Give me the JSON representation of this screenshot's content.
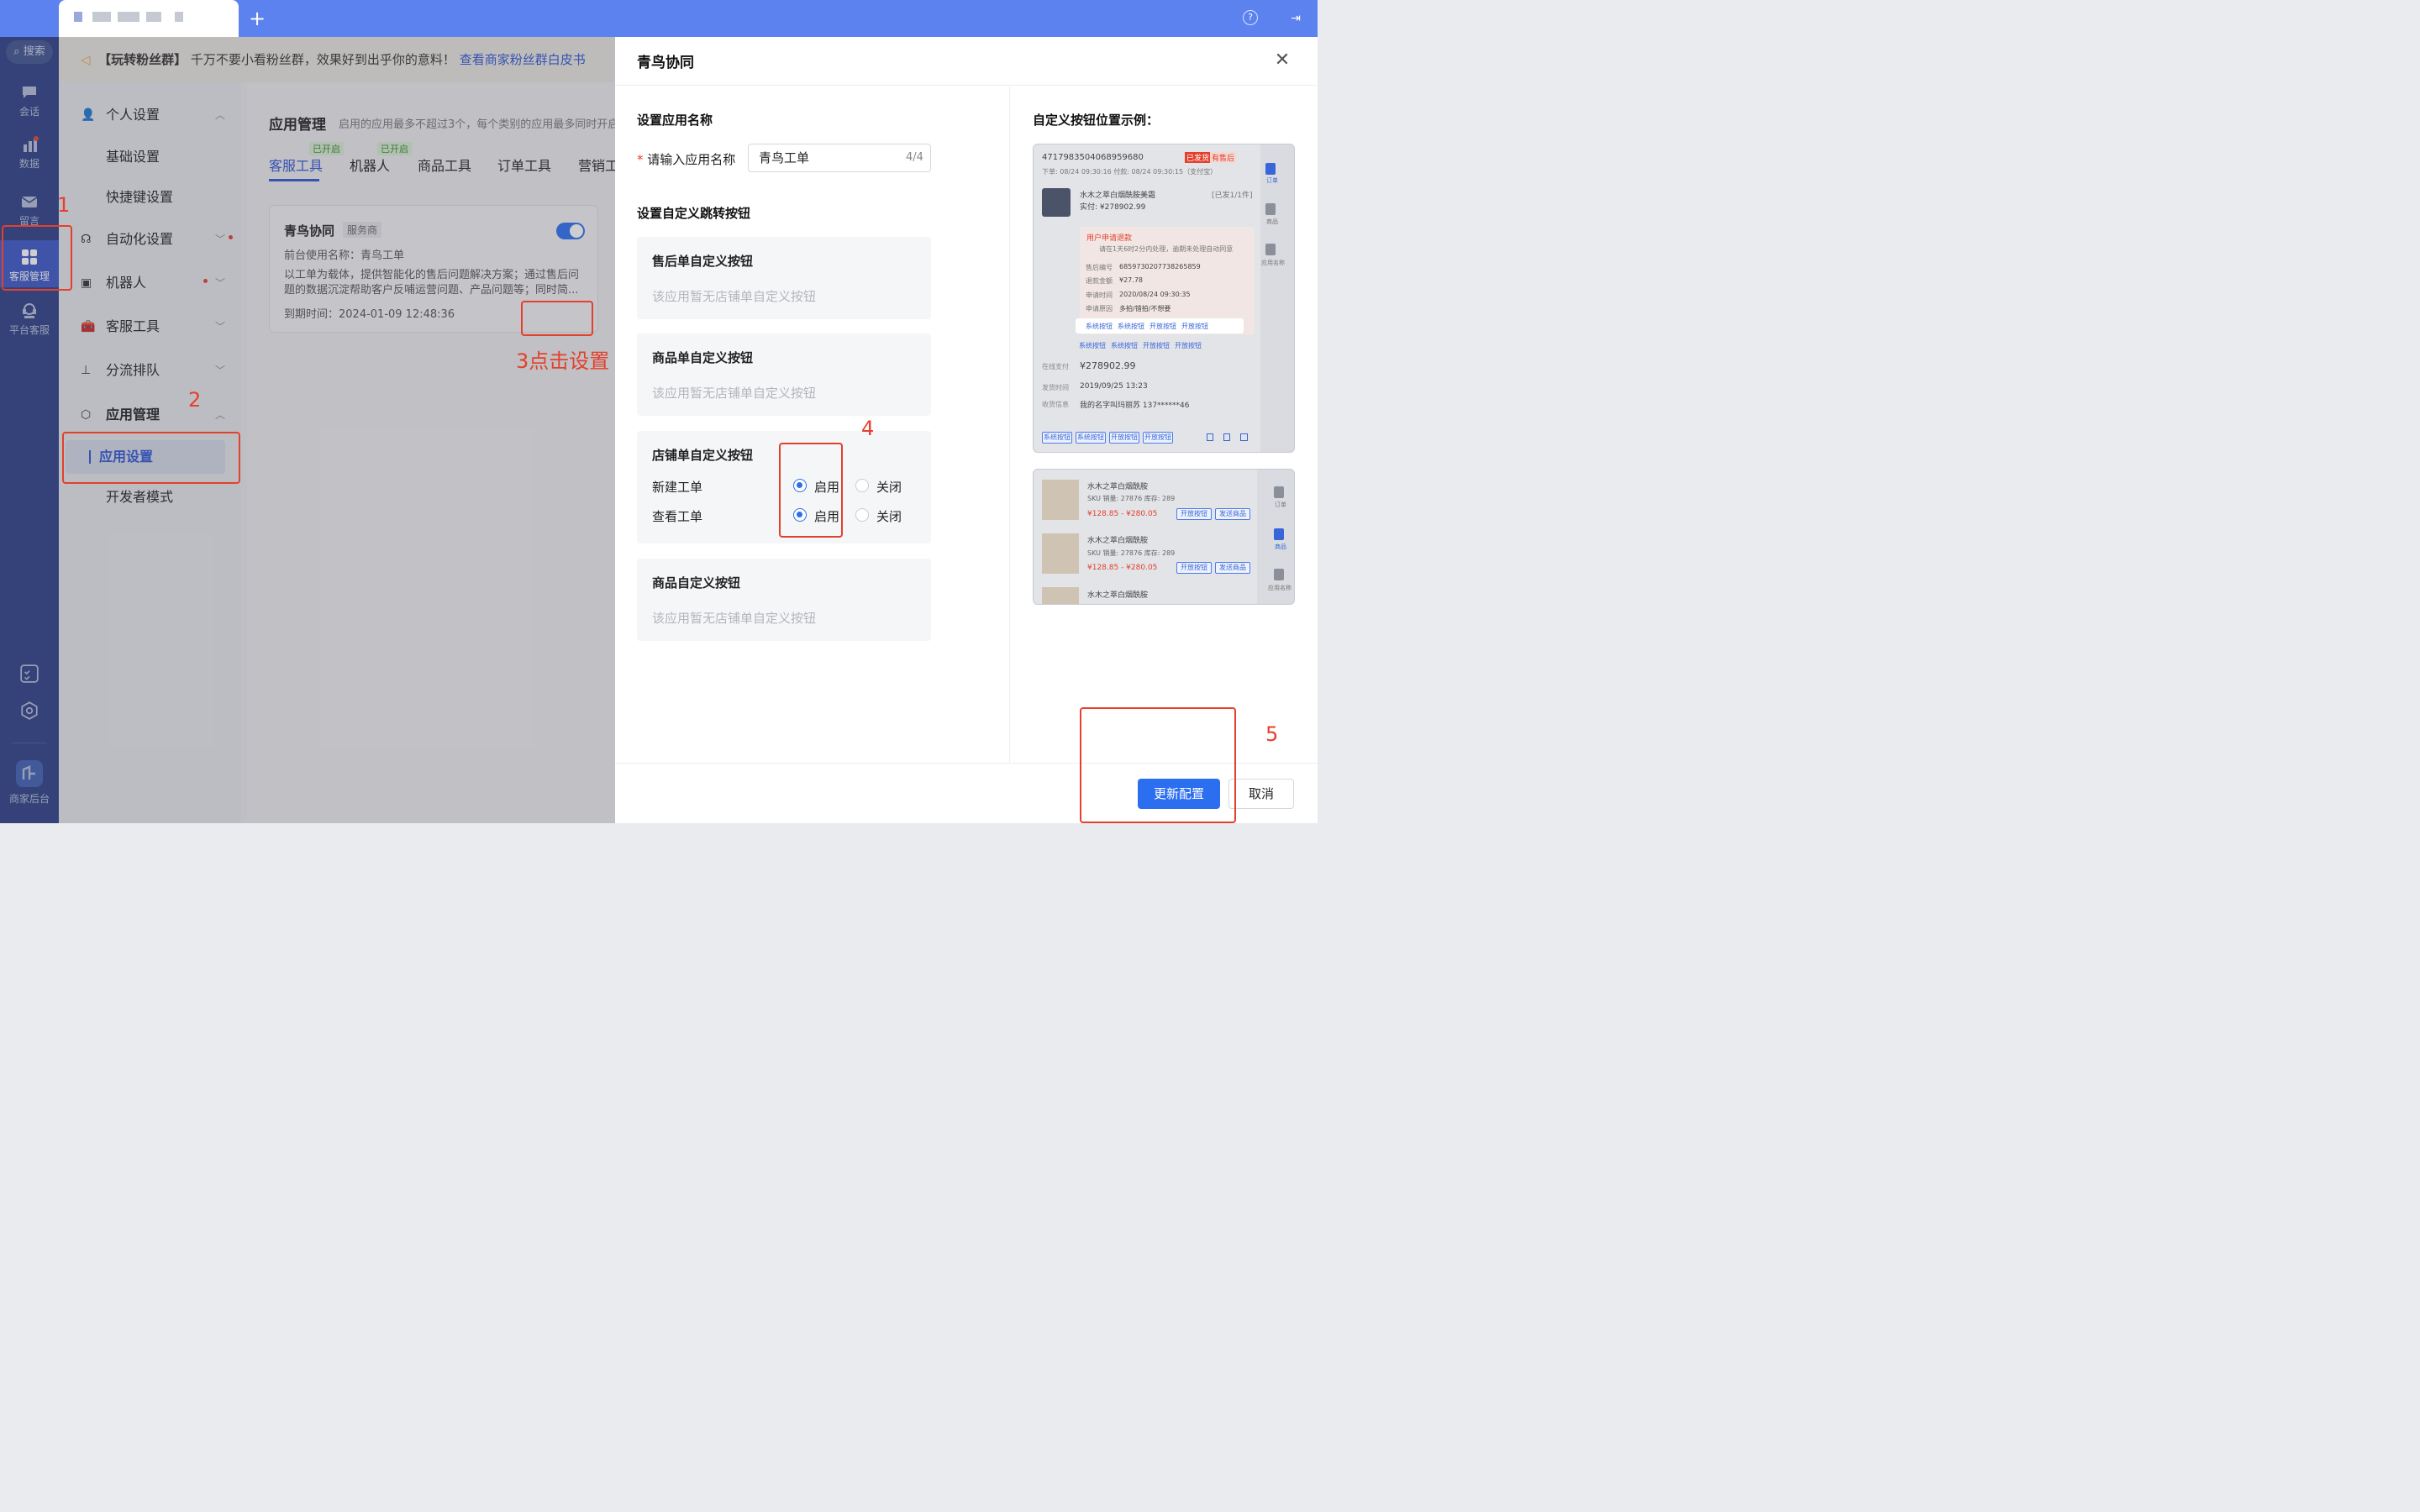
{
  "topbar": {
    "new_tab": "+",
    "help": "?",
    "exit": "⇥"
  },
  "sidebar": {
    "search_label": "搜索",
    "items": [
      {
        "label": "会话"
      },
      {
        "label": "数据"
      },
      {
        "label": "留言"
      },
      {
        "label": "客服管理"
      },
      {
        "label": "平台客服"
      },
      {
        "label": "商家后台"
      }
    ]
  },
  "banner": {
    "tag": "【玩转粉丝群】",
    "text": "千万不要小看粉丝群，效果好到出乎你的意料！",
    "link": "查看商家粉丝群白皮书"
  },
  "settings_nav": [
    {
      "label": "个人设置"
    },
    {
      "label": "基础设置"
    },
    {
      "label": "快捷键设置"
    },
    {
      "label": "自动化设置"
    },
    {
      "label": "机器人"
    },
    {
      "label": "客服工具"
    },
    {
      "label": "分流排队"
    },
    {
      "label": "应用管理"
    },
    {
      "label": "应用设置"
    },
    {
      "label": "开发者模式"
    }
  ],
  "main": {
    "title": "应用管理",
    "subtitle": "启用的应用最多不超过3个，每个类别的应用最多同时开启",
    "tabs": [
      {
        "label": "客服工具",
        "badge": "已开启"
      },
      {
        "label": "机器人",
        "badge": "已开启"
      },
      {
        "label": "商品工具",
        "badge": ""
      },
      {
        "label": "订单工具",
        "badge": ""
      },
      {
        "label": "营销工",
        "badge": ""
      }
    ],
    "card": {
      "name": "青鸟协同",
      "provider": "服务商",
      "frontend_name": "前台使用名称：青鸟工单",
      "desc": "以工单为载体，提供智能化的售后问题解决方案；通过售后问题的数据沉淀帮助客户反哺运营问题、产品问题等；同时简...",
      "expire": "到期时间：2024-01-09 12:48:36"
    }
  },
  "drawer": {
    "title": "青鸟协同",
    "section_name_title": "设置应用名称",
    "name_field_label": "请输入应用名称",
    "name_required_mark": "*",
    "name_value": "青鸟工单",
    "name_count": "4/4",
    "section_jump_title": "设置自定义跳转按钮",
    "aftersale": {
      "title": "售后单自定义按钮",
      "placeholder": "该应用暂无店铺单自定义按钮"
    },
    "goods_order": {
      "title": "商品单自定义按钮",
      "placeholder": "该应用暂无店铺单自定义按钮"
    },
    "shop_order": {
      "title": "店铺单自定义按钮",
      "rows": [
        {
          "label": "新建工单",
          "on": "启用",
          "off": "关闭",
          "selected": "on"
        },
        {
          "label": "查看工单",
          "on": "启用",
          "off": "关闭",
          "selected": "on"
        }
      ]
    },
    "goods": {
      "title": "商品自定义按钮",
      "placeholder": "该应用暂无店铺单自定义按钮"
    },
    "preview_title": "自定义按钮位置示例：",
    "primary_button": "更新配置",
    "cancel_button": "取消"
  },
  "preview_order": {
    "order_no": "4717983504068959680",
    "tag1": "已发货",
    "tag2": "有售后",
    "times": "下单: 08/24 09:30:16  付款: 08/24 09:30:15（支付宝）",
    "product": "水木之萃白烟酰胺美霜",
    "qty": "[已发1/1件]",
    "paid": "实付: ¥278902.99",
    "refund_title": "用户申请退款",
    "refund_tip": "请在1天6时2分内处理，逾期未处理自动同意",
    "refund_rows": [
      {
        "k": "售后编号",
        "v": "6859730207738265859"
      },
      {
        "k": "退款金额",
        "v": "¥27.78"
      },
      {
        "k": "申请时间",
        "v": "2020/08/24 09:30:35"
      },
      {
        "k": "申请原因",
        "v": "多拍/错拍/不想要"
      }
    ],
    "chips_a": [
      "系统按钮",
      "系统按钮",
      "开放按钮",
      "开放按钮"
    ],
    "chips_b": [
      "系统按钮",
      "系统按钮",
      "开放按钮",
      "开放按钮"
    ],
    "online_pay_label": "在线支付",
    "online_pay": "¥278902.99",
    "ship_label": "发货时间",
    "ship_time": "2019/09/25  13:23",
    "addr_label": "收货信息",
    "addr": "我的名字叫玛丽苏  137******46",
    "chips_c": [
      "系统按钮",
      "系统按钮",
      "开放按钮",
      "开放按钮"
    ],
    "side": [
      "订单",
      "商品",
      "应用名称"
    ]
  },
  "preview_goods": {
    "items": [
      {
        "name": "水木之萃白烟酰胺",
        "meta": "SKU  销量: 27876  库存: 289",
        "price": "¥128.85 - ¥280.05"
      },
      {
        "name": "水木之萃白烟酰胺",
        "meta": "SKU  销量: 27876  库存: 289",
        "price": "¥128.85 - ¥280.05"
      },
      {
        "name": "水木之萃白烟酰胺",
        "meta": "",
        "price": ""
      }
    ],
    "btn1": "开放按钮",
    "btn2": "发送商品",
    "side": [
      "订单",
      "商品",
      "应用名称"
    ]
  },
  "annotations": {
    "n1": "1",
    "n2": "2",
    "n3": "3点击设置",
    "n4": "4",
    "n5": "5"
  },
  "colors": {
    "accent": "#2c6ef0",
    "topbar": "#5b82ee",
    "sidebar": "#2a3e86",
    "annotation": "#e4402c"
  }
}
